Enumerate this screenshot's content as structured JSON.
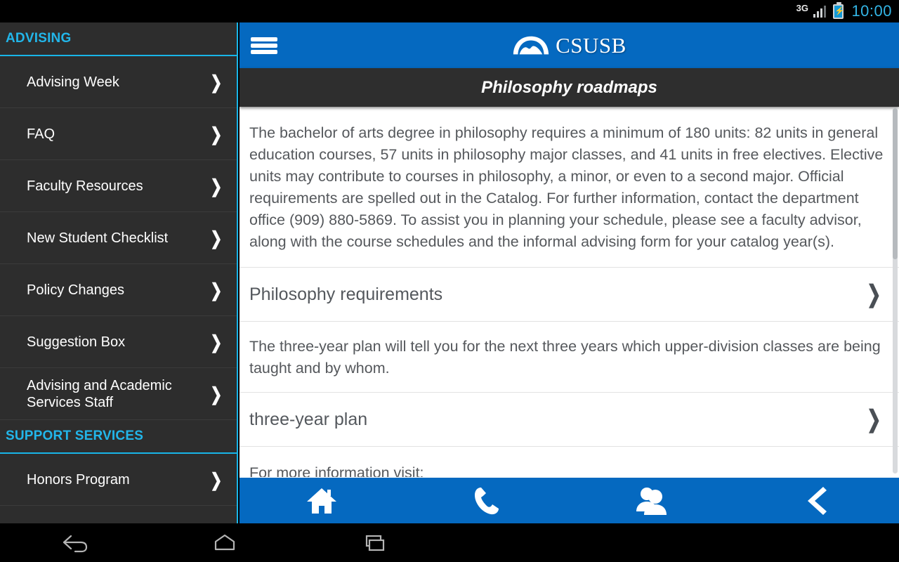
{
  "status_bar": {
    "network": "3G",
    "battery_icon": "battery-charging-icon",
    "signal_icon": "signal-bars-icon",
    "time": "10:00"
  },
  "sidebar": {
    "sections": [
      {
        "title": "ADVISING",
        "items": [
          {
            "label": "Advising Week"
          },
          {
            "label": "FAQ"
          },
          {
            "label": "Faculty Resources"
          },
          {
            "label": "New Student Checklist"
          },
          {
            "label": "Policy Changes"
          },
          {
            "label": "Suggestion Box"
          },
          {
            "label": "Advising and Academic Services Staff"
          }
        ]
      },
      {
        "title": "SUPPORT SERVICES",
        "items": [
          {
            "label": "Honors Program"
          }
        ]
      }
    ]
  },
  "app_bar": {
    "menu_icon": "hamburger-menu-icon",
    "logo_icon": "csusb-arch-logo-icon",
    "brand": "CSUSB"
  },
  "page": {
    "title": "Philosophy roadmaps"
  },
  "content": {
    "intro_paragraph": "The bachelor of arts degree in philosophy requires a minimum of 180 units: 82 units in general education courses, 57 units in philosophy major classes, and 41 units in free electives. Elective units may contribute to courses in philosophy, a minor, or even to a second major. Official requirements are spelled out in the Catalog. For further information, contact the department office (909) 880-5869. To assist you in planning your schedule, please see a faculty advisor, along with the course schedules and the informal advising form for your catalog year(s).",
    "link_requirements": "Philosophy requirements",
    "three_year_paragraph": "The three-year plan will tell you for the next three years which upper-division classes are being taught and by whom.",
    "link_three_year": "three-year plan",
    "more_info_label": "For more information visit:"
  },
  "toolbar": {
    "buttons": [
      {
        "name": "home-icon",
        "label": "Home"
      },
      {
        "name": "phone-icon",
        "label": "Call"
      },
      {
        "name": "contacts-icon",
        "label": "Contacts"
      },
      {
        "name": "back-chevron-icon",
        "label": "Back"
      }
    ]
  },
  "nav_bar": {
    "buttons": [
      {
        "name": "android-back-icon",
        "label": "Back"
      },
      {
        "name": "android-home-icon",
        "label": "Home"
      },
      {
        "name": "android-recents-icon",
        "label": "Recents"
      }
    ]
  },
  "colors": {
    "brand_blue": "#0569c0",
    "accent_cyan": "#22b6ea",
    "sidebar_bg": "#2d2d2d",
    "title_bar_bg": "#2e2e2e",
    "body_text": "#55585c"
  }
}
